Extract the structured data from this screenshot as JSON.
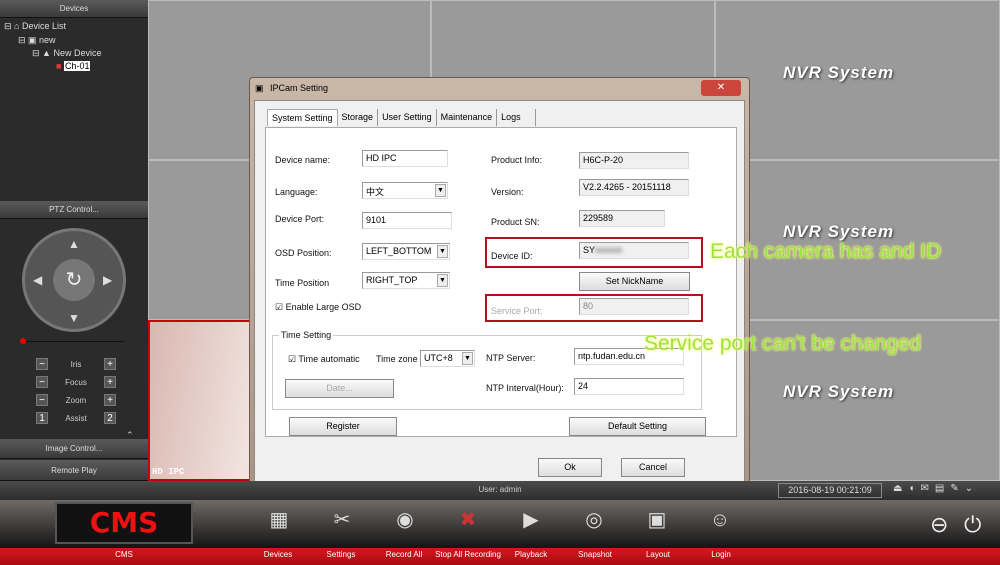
{
  "left_panel": {
    "header": "Devices",
    "tree": [
      {
        "label": "Device List",
        "icon": "home-icon"
      },
      {
        "label": "new",
        "icon": "map-icon"
      },
      {
        "label": "New Device",
        "icon": "dvr-icon"
      },
      {
        "label": "Ch-01",
        "icon": "camera-icon"
      }
    ],
    "ptz_header": "PTZ Control...",
    "ptz_rows": [
      {
        "left": "−",
        "label": "Iris",
        "right": "+"
      },
      {
        "left": "−",
        "label": "Focus",
        "right": "+"
      },
      {
        "left": "−",
        "label": "Zoom",
        "right": "+"
      },
      {
        "left": "1",
        "label": "Assist",
        "right": "2"
      }
    ],
    "image_control": "Image Control...",
    "remote_play": "Remote Play",
    "collapse": "«"
  },
  "video": {
    "watermark": [
      "NVR System",
      "NVR System",
      "NVR System"
    ],
    "tile_osd": "HD IPC"
  },
  "dialog": {
    "title": "IPCam Setting",
    "close": "✕",
    "tabs": [
      "System Setting",
      "Storage",
      "User Setting",
      "Maintenance",
      "Logs"
    ],
    "active_tab": "System Setting",
    "fields": {
      "device_name_label": "Device name:",
      "device_name": "HD IPC",
      "language_label": "Language:",
      "language": "中文",
      "device_port_label": "Device Port:",
      "device_port": "9101",
      "osd_position_label": "OSD Position:",
      "osd_position": "LEFT_BOTTOM",
      "time_position_label": "Time Position",
      "time_position": "RIGHT_TOP",
      "enable_large_osd": "Enable Large OSD",
      "product_info_label": "Product Info:",
      "product_info": "H6C-P-20",
      "version_label": "Version:",
      "version": "V2.2.4265 - 20151118",
      "product_sn_label": "Product SN:",
      "product_sn": "229589",
      "device_id_label": "Device ID:",
      "device_id": "SY",
      "set_nickname": "Set NickName",
      "service_port_label": "Service Port:",
      "service_port": "80"
    },
    "time_setting": {
      "legend": "Time Setting",
      "time_automatic": "Time automatic",
      "time_zone_label": "Time zone",
      "time_zone": "UTC+8",
      "date_button": "Date...",
      "ntp_server_label": "NTP Server:",
      "ntp_server": "ntp.fudan.edu.cn",
      "ntp_interval_label": "NTP Interval(Hour):",
      "ntp_interval": "24"
    },
    "register": "Register",
    "default_setting": "Default Setting",
    "ok": "Ok",
    "cancel": "Cancel"
  },
  "annotations": {
    "device_id_note": "Each camera has and ID",
    "service_port_note": "Service port can't be changed"
  },
  "status_bar": {
    "user": "User: admin",
    "datetime": "2016-08-19 00:21:09",
    "icons": [
      "eject-icon",
      "speaker-icon",
      "mail-icon",
      "screens-icon",
      "pin-icon",
      "chevron-down-icon"
    ]
  },
  "toolbar": {
    "logo": "CMS",
    "logo_label": "CMS",
    "items": [
      {
        "label": "Devices",
        "icon": "devices-icon"
      },
      {
        "label": "Settings",
        "icon": "settings-icon"
      },
      {
        "label": "Record All",
        "icon": "record-icon"
      },
      {
        "label": "Stop All Recording",
        "icon": "stop-record-icon"
      },
      {
        "label": "Playback",
        "icon": "playback-icon"
      },
      {
        "label": "Snapshot",
        "icon": "snapshot-icon"
      },
      {
        "label": "Layout",
        "icon": "layout-icon"
      },
      {
        "label": "Login",
        "icon": "login-icon"
      }
    ]
  },
  "colors": {
    "accent_red": "#c8101a",
    "annotation_green": "#9be33d",
    "highlight_box": "#b3111b"
  }
}
